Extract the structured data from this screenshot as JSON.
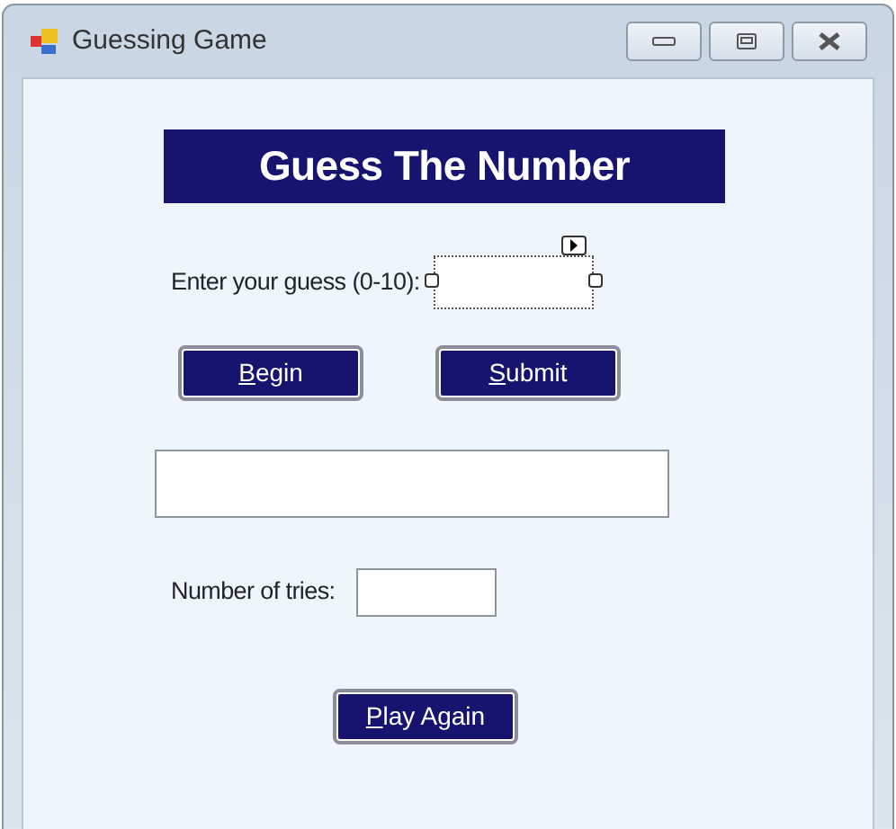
{
  "window": {
    "title": "Guessing Game"
  },
  "heading": "Guess The Number",
  "guess": {
    "label": "Enter your guess (0-10):",
    "selected": true
  },
  "buttons": [
    {
      "label": "Begin"
    },
    {
      "label": "Submit"
    }
  ],
  "tries": {
    "label": "Number of tries:"
  },
  "play_again": {
    "label": "Play Again"
  }
}
